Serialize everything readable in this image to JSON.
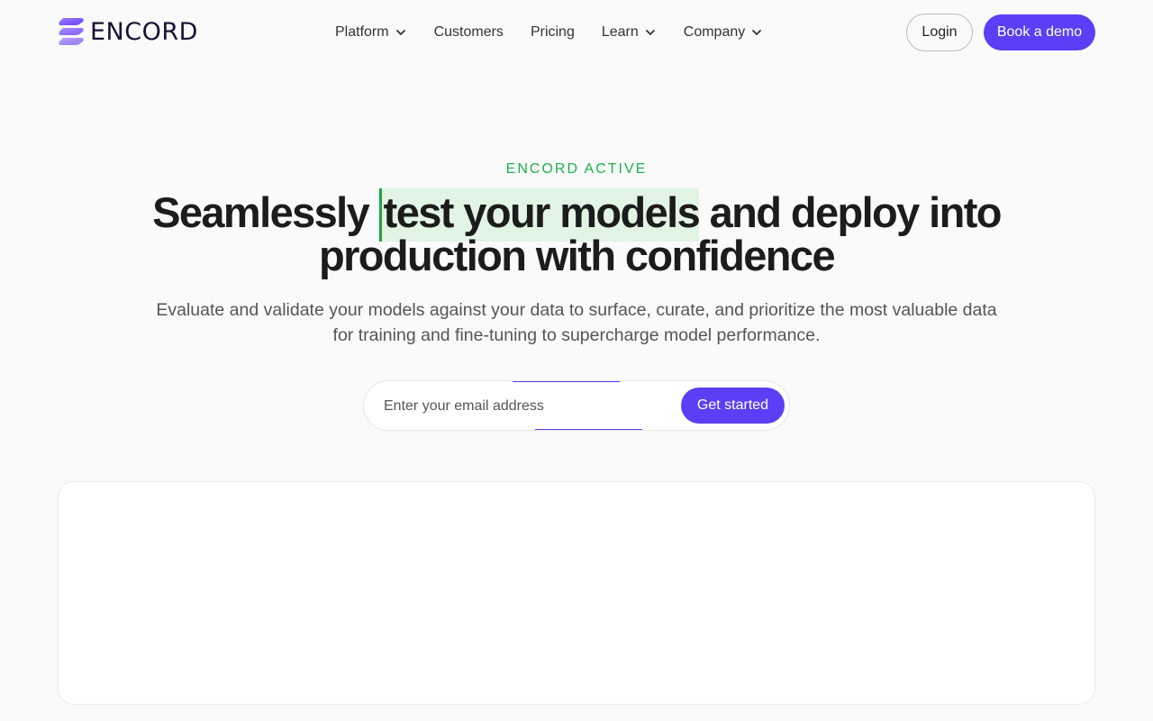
{
  "brand": {
    "name": "ENCORD",
    "accent": "#5b3ff6",
    "green": "#19b34a"
  },
  "nav": {
    "items": [
      {
        "label": "Platform",
        "has_dropdown": true
      },
      {
        "label": "Customers",
        "has_dropdown": false
      },
      {
        "label": "Pricing",
        "has_dropdown": false
      },
      {
        "label": "Learn",
        "has_dropdown": true
      },
      {
        "label": "Company",
        "has_dropdown": true
      }
    ],
    "login_label": "Login",
    "demo_label": "Book a demo"
  },
  "hero": {
    "eyebrow": "ENCORD ACTIVE",
    "headline_pre": "Seamlessly ",
    "headline_highlight": "test your models",
    "headline_post": " and deploy into production with confidence",
    "subtitle": "Evaluate and validate your models against your data to surface, curate, and prioritize the most valuable data for training and fine-tuning to supercharge model performance.",
    "email_placeholder": "Enter your email address",
    "cta_label": "Get started"
  }
}
